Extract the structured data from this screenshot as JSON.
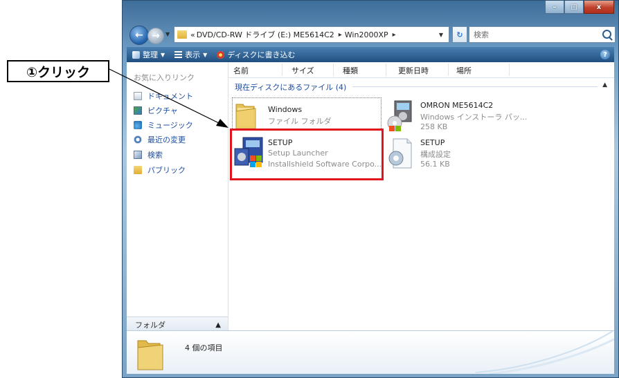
{
  "callout": {
    "label": "①クリック"
  },
  "window": {
    "title_buttons": [
      "minimize",
      "maximize",
      "close"
    ],
    "address": {
      "prefix": "«",
      "segments": [
        "DVD/CD-RW ドライブ (E:) ME5614C2",
        "Win2000XP"
      ]
    },
    "search_placeholder": "検索"
  },
  "toolbar": {
    "organize": "整理",
    "views": "表示",
    "burn": "ディスクに書き込む"
  },
  "navpane": {
    "header": "お気に入りリンク",
    "links": [
      {
        "label": "ドキュメント",
        "icon": "documents-icon"
      },
      {
        "label": "ピクチャ",
        "icon": "pictures-icon"
      },
      {
        "label": "ミュージック",
        "icon": "music-icon"
      },
      {
        "label": "最近の変更",
        "icon": "recent-icon"
      },
      {
        "label": "検索",
        "icon": "search-folder-icon"
      },
      {
        "label": "パブリック",
        "icon": "public-folder-icon"
      }
    ],
    "folders_label": "フォルダ"
  },
  "columns": [
    "名前",
    "サイズ",
    "種類",
    "更新日時",
    "場所"
  ],
  "group_label": "現在ディスクにあるファイル (4)",
  "files": [
    {
      "name": "Windows",
      "line2": "ファイル フォルダ",
      "line3": "",
      "icon": "folder-icon"
    },
    {
      "name": "OMRON ME5614C2",
      "line2": "Windows インストーラ パッ...",
      "line3": "258 KB",
      "icon": "installer-package-icon"
    },
    {
      "name": "SETUP",
      "line2": "Setup Launcher",
      "line3": "Installshield Software Corpo...",
      "icon": "setup-launcher-icon"
    },
    {
      "name": "SETUP",
      "line2": "構成設定",
      "line3": "56.1 KB",
      "icon": "config-settings-icon"
    }
  ],
  "status": {
    "count": "4 個の項目"
  },
  "colors": {
    "highlight": "#e3131e",
    "toolbar": "#2d5f92",
    "link": "#1f4fa0"
  }
}
